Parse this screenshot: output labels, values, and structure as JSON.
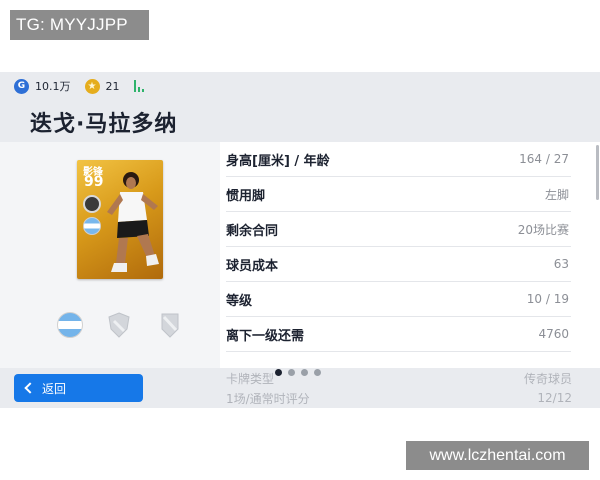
{
  "watermarks": {
    "top": "TG: MYYJJPP",
    "bottom": "www.lczhentai.com"
  },
  "topbar": {
    "gp_amount": "10.1万",
    "coin_amount": "21",
    "icons": [
      "g-coin-icon",
      "star-coin-icon",
      "signal-icon"
    ]
  },
  "player_name": "迭戈·马拉多纳",
  "card": {
    "position": "影锋",
    "rating": "99",
    "nationality_flag": "argentina"
  },
  "stats": [
    {
      "label": "身高[厘米] / 年龄",
      "value": "164 / 27"
    },
    {
      "label": "惯用脚",
      "value": "左脚"
    },
    {
      "label": "剩余合同",
      "value": "20场比赛"
    },
    {
      "label": "球员成本",
      "value": "63"
    },
    {
      "label": "等级",
      "value": "10 / 19"
    },
    {
      "label": "离下一级还需",
      "value": "4760"
    }
  ],
  "partially_visible_rows": [
    {
      "label": "卡牌类型",
      "value": "传奇球员"
    },
    {
      "label": "1场/通常时评分",
      "value": "12/12"
    }
  ],
  "back_button": {
    "label": "返回"
  },
  "pagination": {
    "total": 4,
    "active": 0
  },
  "colors": {
    "accent": "#1678e8",
    "card_gold": "#d89a1a",
    "background": "#e9ebef"
  }
}
